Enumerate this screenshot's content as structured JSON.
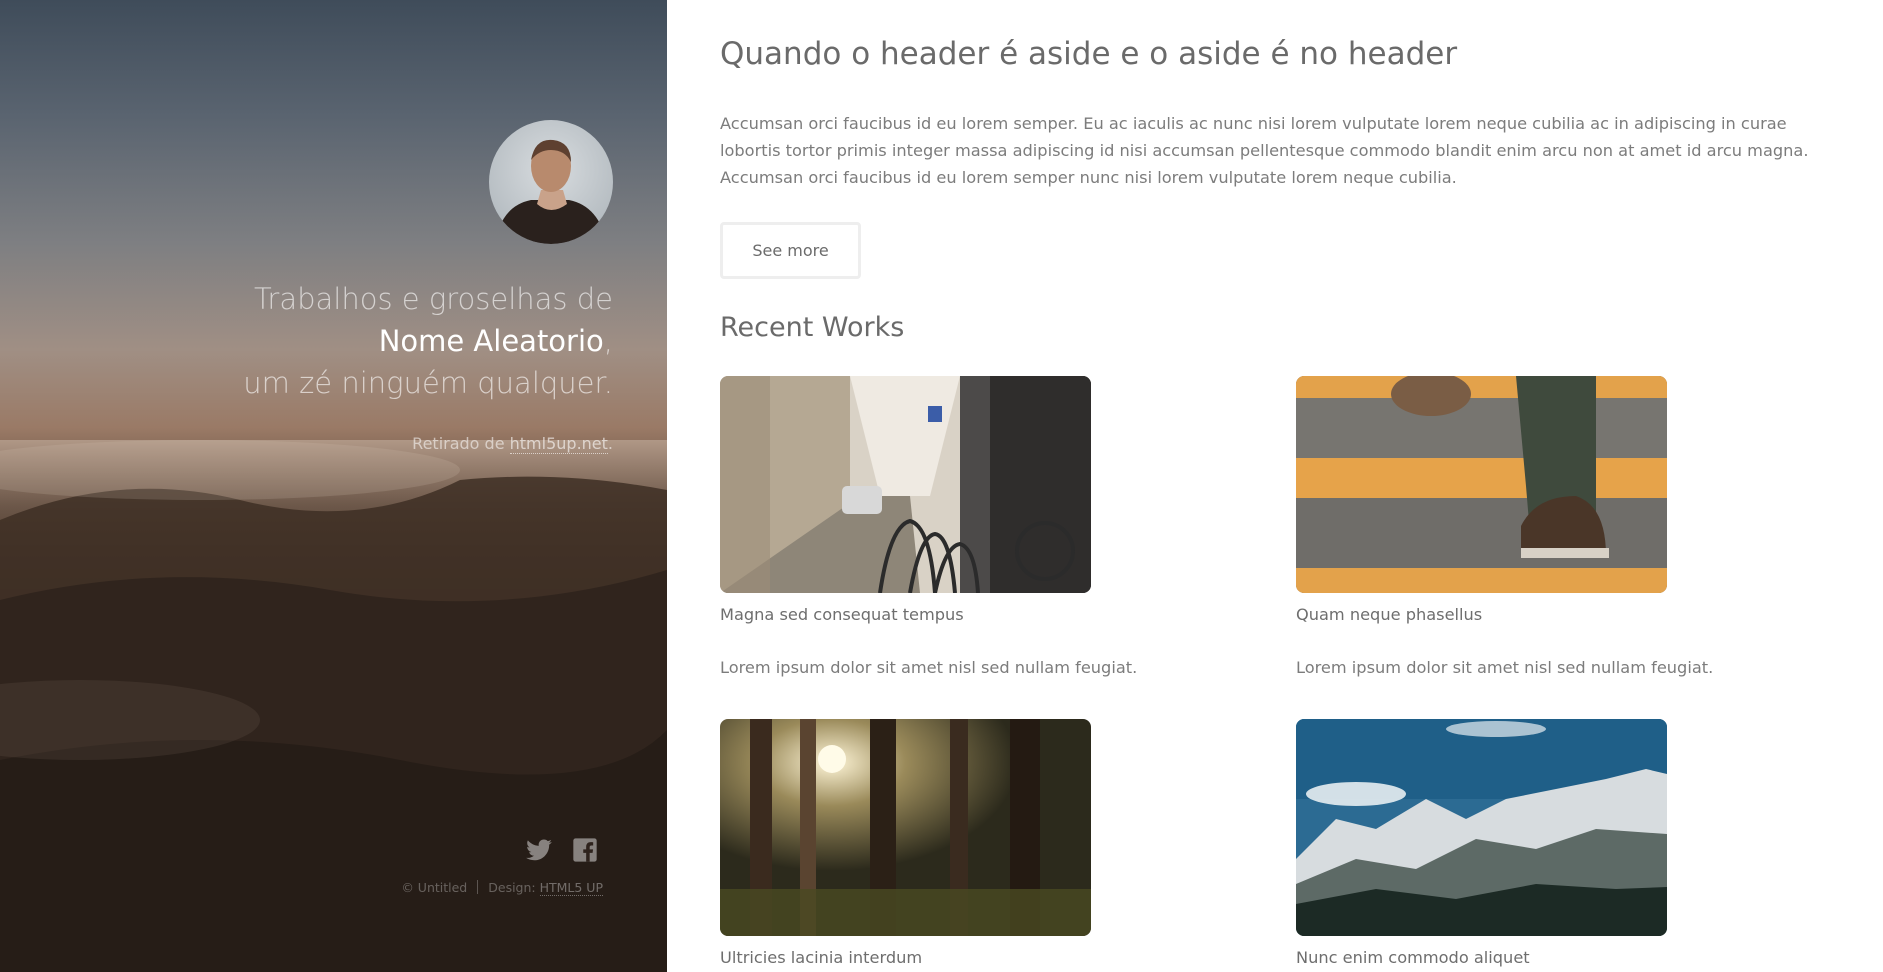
{
  "sidebar": {
    "tagline_line1": "Trabalhos e groselhas de",
    "tagline_name": "Nome Aleatorio",
    "tagline_comma": ",",
    "tagline_line3": "um zé ninguém qualquer.",
    "source_prefix": "Retirado de ",
    "source_link": "html5up.net",
    "source_suffix": ".",
    "social_icons": [
      "twitter-icon",
      "facebook-icon"
    ],
    "copyright": "© Untitled",
    "design_label": "Design: ",
    "design_link": "HTML5 UP"
  },
  "main": {
    "title": "Quando o header é aside e o aside é no header",
    "intro": "Accumsan orci faucibus id eu lorem semper. Eu ac iaculis ac nunc nisi lorem vulputate lorem neque cubilia ac in adipiscing in curae lobortis tortor primis integer massa adipiscing id nisi accumsan pellentesque commodo blandit enim arcu non at amet id arcu magna. Accumsan orci faucibus id eu lorem semper nunc nisi lorem vulputate lorem neque cubilia.",
    "see_more_label": "See more",
    "recent_works_title": "Recent Works",
    "works": [
      {
        "title": "Magna sed consequat tempus",
        "description": "Lorem ipsum dolor sit amet nisl sed nullam feugiat."
      },
      {
        "title": "Quam neque phasellus",
        "description": "Lorem ipsum dolor sit amet nisl sed nullam feugiat."
      },
      {
        "title": "Ultricies lacinia interdum",
        "description": ""
      },
      {
        "title": "Nunc enim commodo aliquet",
        "description": ""
      }
    ]
  }
}
